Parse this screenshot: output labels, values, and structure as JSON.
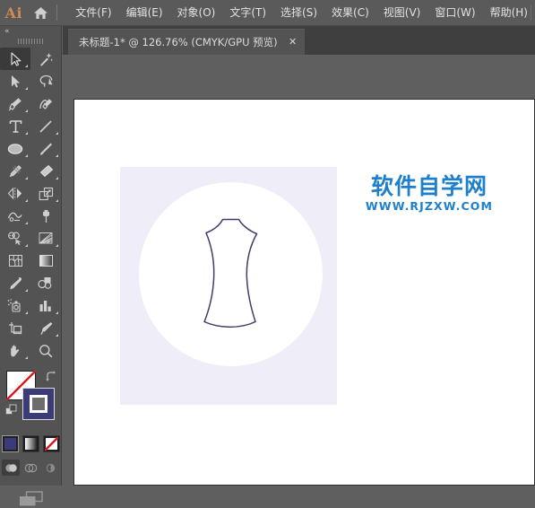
{
  "app": {
    "logo_text": "Ai",
    "logo_color": "#cf8c54",
    "home_icon": "home-icon"
  },
  "menubar": {
    "items": [
      {
        "label": "文件(F)",
        "name": "menu-file"
      },
      {
        "label": "编辑(E)",
        "name": "menu-edit"
      },
      {
        "label": "对象(O)",
        "name": "menu-object"
      },
      {
        "label": "文字(T)",
        "name": "menu-type"
      },
      {
        "label": "选择(S)",
        "name": "menu-select"
      },
      {
        "label": "效果(C)",
        "name": "menu-effect"
      },
      {
        "label": "视图(V)",
        "name": "menu-view"
      },
      {
        "label": "窗口(W)",
        "name": "menu-window"
      },
      {
        "label": "帮助(H)",
        "name": "menu-help"
      }
    ]
  },
  "tabbar": {
    "tabs": [
      {
        "title": "未标题-1* @ 126.76% (CMYK/GPU 预览)",
        "close_label": "✕",
        "active": true,
        "document_name": "未标题-1",
        "modified": true,
        "zoom": "126.76%",
        "color_mode": "CMYK",
        "renderer": "GPU 预览"
      }
    ]
  },
  "toolbar": {
    "collapse_label": "«",
    "grip": "drag-grip",
    "tools": [
      {
        "name": "selection-tool",
        "icon": "arrow-solid-outline",
        "active": true,
        "flyout": true
      },
      {
        "name": "magic-wand-tool",
        "icon": "magic-wand",
        "active": false,
        "flyout": false
      },
      {
        "name": "direct-selection-tool",
        "icon": "arrow-filled",
        "active": false,
        "flyout": true
      },
      {
        "name": "lasso-tool",
        "icon": "lasso",
        "active": false,
        "flyout": false
      },
      {
        "name": "pen-tool",
        "icon": "pen-nib",
        "active": false,
        "flyout": true
      },
      {
        "name": "curvature-tool",
        "icon": "curvature-pen",
        "active": false,
        "flyout": false
      },
      {
        "name": "type-tool",
        "icon": "type-T",
        "active": false,
        "flyout": true
      },
      {
        "name": "line-segment-tool",
        "icon": "line-diagonal",
        "active": false,
        "flyout": true
      },
      {
        "name": "ellipse-tool",
        "icon": "ellipse",
        "active": false,
        "flyout": true
      },
      {
        "name": "paintbrush-tool",
        "icon": "paintbrush",
        "active": false,
        "flyout": true
      },
      {
        "name": "pencil-tool",
        "icon": "pencil-shaper",
        "active": false,
        "flyout": true
      },
      {
        "name": "eraser-tool",
        "icon": "eraser",
        "active": false,
        "flyout": true
      },
      {
        "name": "rotate-reflect-tool",
        "icon": "reflect",
        "active": false,
        "flyout": true
      },
      {
        "name": "scale-tool",
        "icon": "scale-arrow-box",
        "active": false,
        "flyout": true
      },
      {
        "name": "width-warp-tool",
        "icon": "width-warp",
        "active": false,
        "flyout": true
      },
      {
        "name": "free-transform-tool",
        "icon": "pushpin",
        "active": false,
        "flyout": false
      },
      {
        "name": "shape-builder-tool",
        "icon": "shape-builder",
        "active": false,
        "flyout": true
      },
      {
        "name": "perspective-grid-tool",
        "icon": "perspective-grid",
        "active": false,
        "flyout": true
      },
      {
        "name": "mesh-tool",
        "icon": "mesh",
        "active": false,
        "flyout": false
      },
      {
        "name": "gradient-tool",
        "icon": "gradient-square",
        "active": false,
        "flyout": false
      },
      {
        "name": "eyedropper-tool",
        "icon": "eyedropper",
        "active": false,
        "flyout": true
      },
      {
        "name": "blend-tool",
        "icon": "blend-circles",
        "active": false,
        "flyout": false
      },
      {
        "name": "symbol-sprayer-tool",
        "icon": "symbol-sprayer",
        "active": false,
        "flyout": true
      },
      {
        "name": "column-graph-tool",
        "icon": "bar-chart",
        "active": false,
        "flyout": true
      },
      {
        "name": "artboard-tool",
        "icon": "artboard-crop",
        "active": false,
        "flyout": false
      },
      {
        "name": "slice-tool",
        "icon": "slice-knife",
        "active": false,
        "flyout": true
      },
      {
        "name": "hand-tool",
        "icon": "hand",
        "active": false,
        "flyout": true
      },
      {
        "name": "zoom-tool",
        "icon": "magnifier",
        "active": false,
        "flyout": false
      }
    ],
    "fill": {
      "name": "fill-swatch",
      "value": "none",
      "color": "#ffffff",
      "none_slash_color": "#e01b20"
    },
    "stroke": {
      "name": "stroke-swatch",
      "color": "#3b3b78"
    },
    "swap_icon": "swap-fill-stroke-icon",
    "default_icon": "default-fill-stroke-icon",
    "paint_modes": [
      {
        "name": "color-mode-button",
        "icon": "solid-color-swatch",
        "selected": true
      },
      {
        "name": "gradient-mode-button",
        "icon": "gradient-swatch",
        "selected": false
      },
      {
        "name": "none-mode-button",
        "icon": "none-swatch",
        "selected": false
      }
    ],
    "draw_modes": [
      {
        "name": "draw-normal-button",
        "icon": "draw-normal-icon",
        "selected": true
      },
      {
        "name": "draw-behind-button",
        "icon": "draw-behind-icon",
        "selected": false
      },
      {
        "name": "draw-inside-button",
        "icon": "draw-inside-icon",
        "selected": false
      }
    ],
    "screen_mode": {
      "name": "change-screen-mode-button",
      "icon": "screen-mode-icon"
    }
  },
  "canvas": {
    "artboard_background": "#ffffff",
    "artwork": {
      "name": "garment-illustration",
      "square_color": "#eeedf8",
      "circle_color": "#ffffff",
      "outline_color": "#3c3c6e",
      "subject": "sleeveless-top-outline"
    },
    "watermark": {
      "cn": "软件自学网",
      "en": "WWW.RJZXW.COM",
      "color": "#1e80cd"
    }
  }
}
